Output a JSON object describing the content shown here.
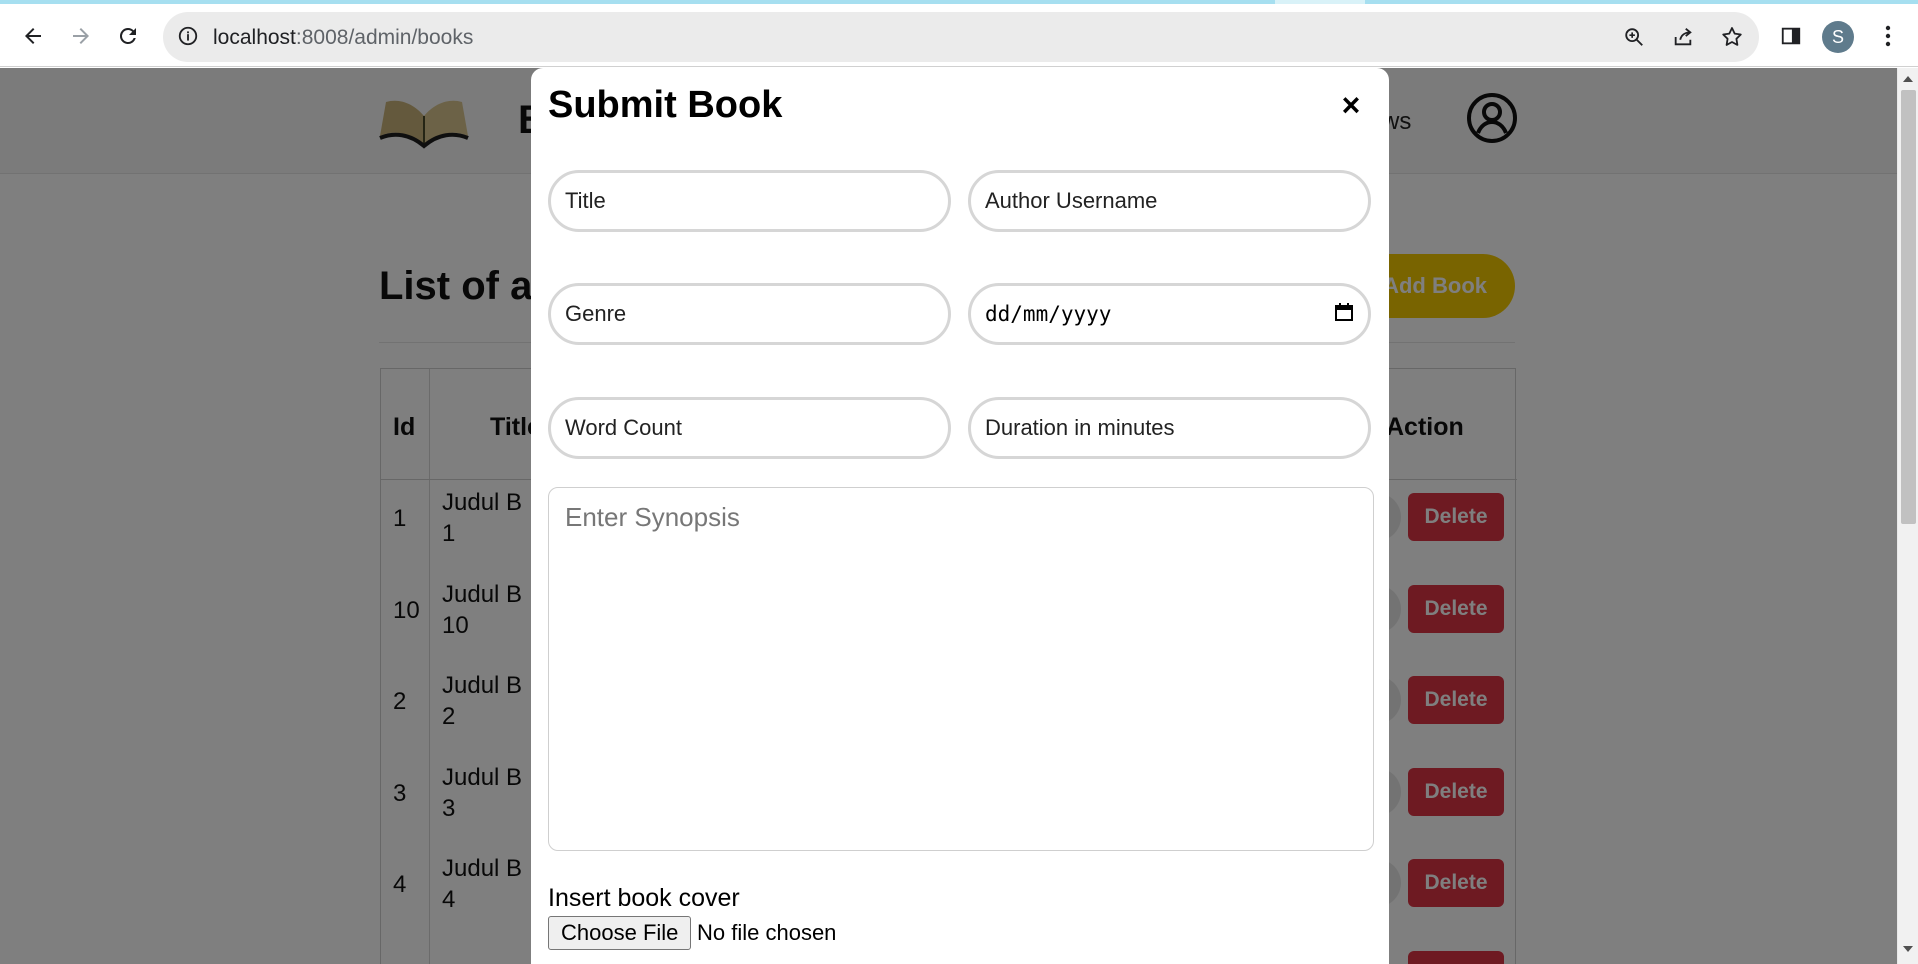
{
  "browser": {
    "url_host": "localhost",
    "url_path": ":8008/admin/books",
    "profile_initial": "S"
  },
  "site": {
    "brand": "B",
    "nav_reviews": "ws",
    "list_title": "List of a",
    "add_book_label": "Add Book"
  },
  "table": {
    "headers": {
      "id": "Id",
      "title": "Title",
      "action": "Action"
    },
    "rows": [
      {
        "id": "1",
        "title_line1": "Judul B",
        "title_line2": "1",
        "delete": "Delete"
      },
      {
        "id": "10",
        "title_line1": "Judul B",
        "title_line2": "10",
        "delete": "Delete"
      },
      {
        "id": "2",
        "title_line1": "Judul B",
        "title_line2": "2",
        "delete": "Delete"
      },
      {
        "id": "3",
        "title_line1": "Judul B",
        "title_line2": "3",
        "delete": "Delete"
      },
      {
        "id": "4",
        "title_line1": "Judul B",
        "title_line2": "4",
        "delete": "Delete"
      }
    ]
  },
  "modal": {
    "title": "Submit Book",
    "close": "×",
    "fields": {
      "title_placeholder": "Title",
      "author_placeholder": "Author Username",
      "genre_placeholder": "Genre",
      "date_placeholder": "dd/mm/yyyy",
      "word_count_placeholder": "Word Count",
      "duration_placeholder": "Duration in minutes",
      "synopsis_placeholder": "Enter Synopsis"
    },
    "cover_label": "Insert book cover",
    "file_button": "Choose File",
    "file_status": "No file chosen"
  }
}
